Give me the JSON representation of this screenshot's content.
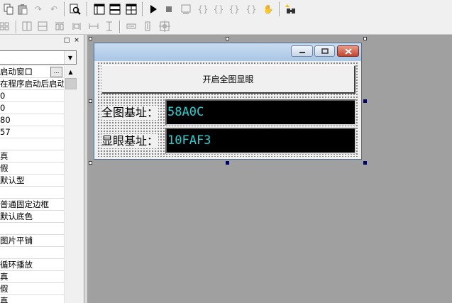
{
  "toolbar_main": {
    "icons": [
      "copy-icon",
      "paste-icon",
      "redo-icon",
      "undo-icon",
      "find-icon",
      "layout-single-icon",
      "layout-split-horizontal-icon",
      "layout-grid-icon",
      "run-icon",
      "stop-icon",
      "step-icon",
      "step-into-icon",
      "step-over-icon",
      "step-out-icon",
      "run-to-cursor-icon",
      "hand-icon",
      "breakpoint-icon"
    ]
  },
  "toolbar_align": {
    "icons": [
      "align-left-icon",
      "align-center-icon",
      "align-top-icon",
      "align-middle-icon",
      "space-horizontal-icon",
      "space-vertical-icon",
      "same-width-icon",
      "same-height-icon",
      "center-icon"
    ]
  },
  "property_panel": {
    "pin_label": "□",
    "close_label": "×",
    "combo_value": "",
    "rows": [
      "启动窗口",
      "在程序启动后启动",
      "0",
      "0",
      "80",
      "57",
      "",
      "真",
      "假",
      "默认型",
      "",
      "普通固定边框",
      "默认底色",
      "",
      "图片平铺",
      "",
      "循环播放",
      "真",
      "假",
      "真"
    ],
    "more_button": "…"
  },
  "form": {
    "title": "",
    "minimize_label": "−",
    "maximize_label": "□",
    "close_label": "✕",
    "open_button_label": "开启全图显眼",
    "map_label": "全图基址：",
    "map_value": "58A0C",
    "eye_label": "显眼基址：",
    "eye_value": "10FAF3"
  },
  "colors": {
    "value_text": "#1fd3d3",
    "value_background": "#000000",
    "canvas": "#a0a0a0"
  }
}
